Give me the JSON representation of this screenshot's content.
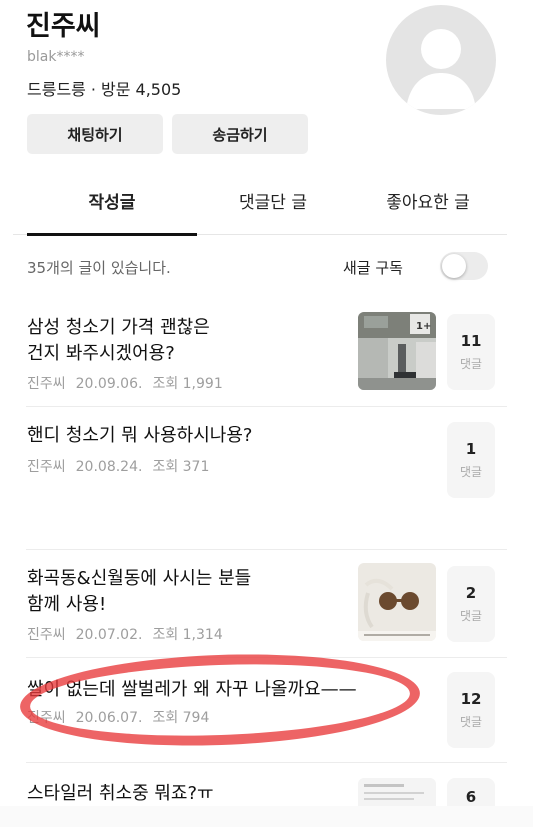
{
  "profile": {
    "name": "진주씨",
    "user_id": "blak****",
    "level": "드릉드릉",
    "visits_label": "방문",
    "visits": "4,505"
  },
  "actions": {
    "chat": "채팅하기",
    "send_money": "송금하기"
  },
  "tabs": [
    {
      "label": "작성글",
      "active": true
    },
    {
      "label": "댓글단 글",
      "active": false
    },
    {
      "label": "좋아요한 글",
      "active": false
    }
  ],
  "list_header": {
    "count_text": "35개의 글이 있습니다.",
    "subscribe_label": "새글 구독",
    "subscribe_on": false
  },
  "posts": [
    {
      "title_lines": [
        "삼성 청소기 가격 괜찮은",
        "건지 봐주시겠어용?"
      ],
      "author": "진주씨",
      "date": "20.09.06.",
      "views": "조회 1,991",
      "comments": "11",
      "comments_label": "댓글"
    },
    {
      "title_lines": [
        "핸디 청소기 뭐 사용하시나용?",
        ""
      ],
      "author": "진주씨",
      "date": "20.08.24.",
      "views": "조회 371",
      "comments": "1",
      "comments_label": "댓글"
    },
    {
      "title_lines": [
        "화곡동&신월동에 사시는 분들",
        "함께 사용!"
      ],
      "author": "진주씨",
      "date": "20.07.02.",
      "views": "조회 1,314",
      "comments": "2",
      "comments_label": "댓글"
    },
    {
      "title_lines": [
        "쌀이 없는데 쌀벌레가 왜 자꾸 나올까요——",
        ""
      ],
      "author": "진주씨",
      "date": "20.06.07.",
      "views": "조회 794",
      "comments": "12",
      "comments_label": "댓글"
    },
    {
      "title_lines": [
        "스타일러 취소중 뭐죠?ㅠ",
        ""
      ],
      "author": "",
      "date": "",
      "views": "",
      "comments": "6",
      "comments_label": ""
    }
  ],
  "colors": {
    "annotation_red": "#e8383a",
    "comment_box_bg": "#f5f5f5"
  }
}
